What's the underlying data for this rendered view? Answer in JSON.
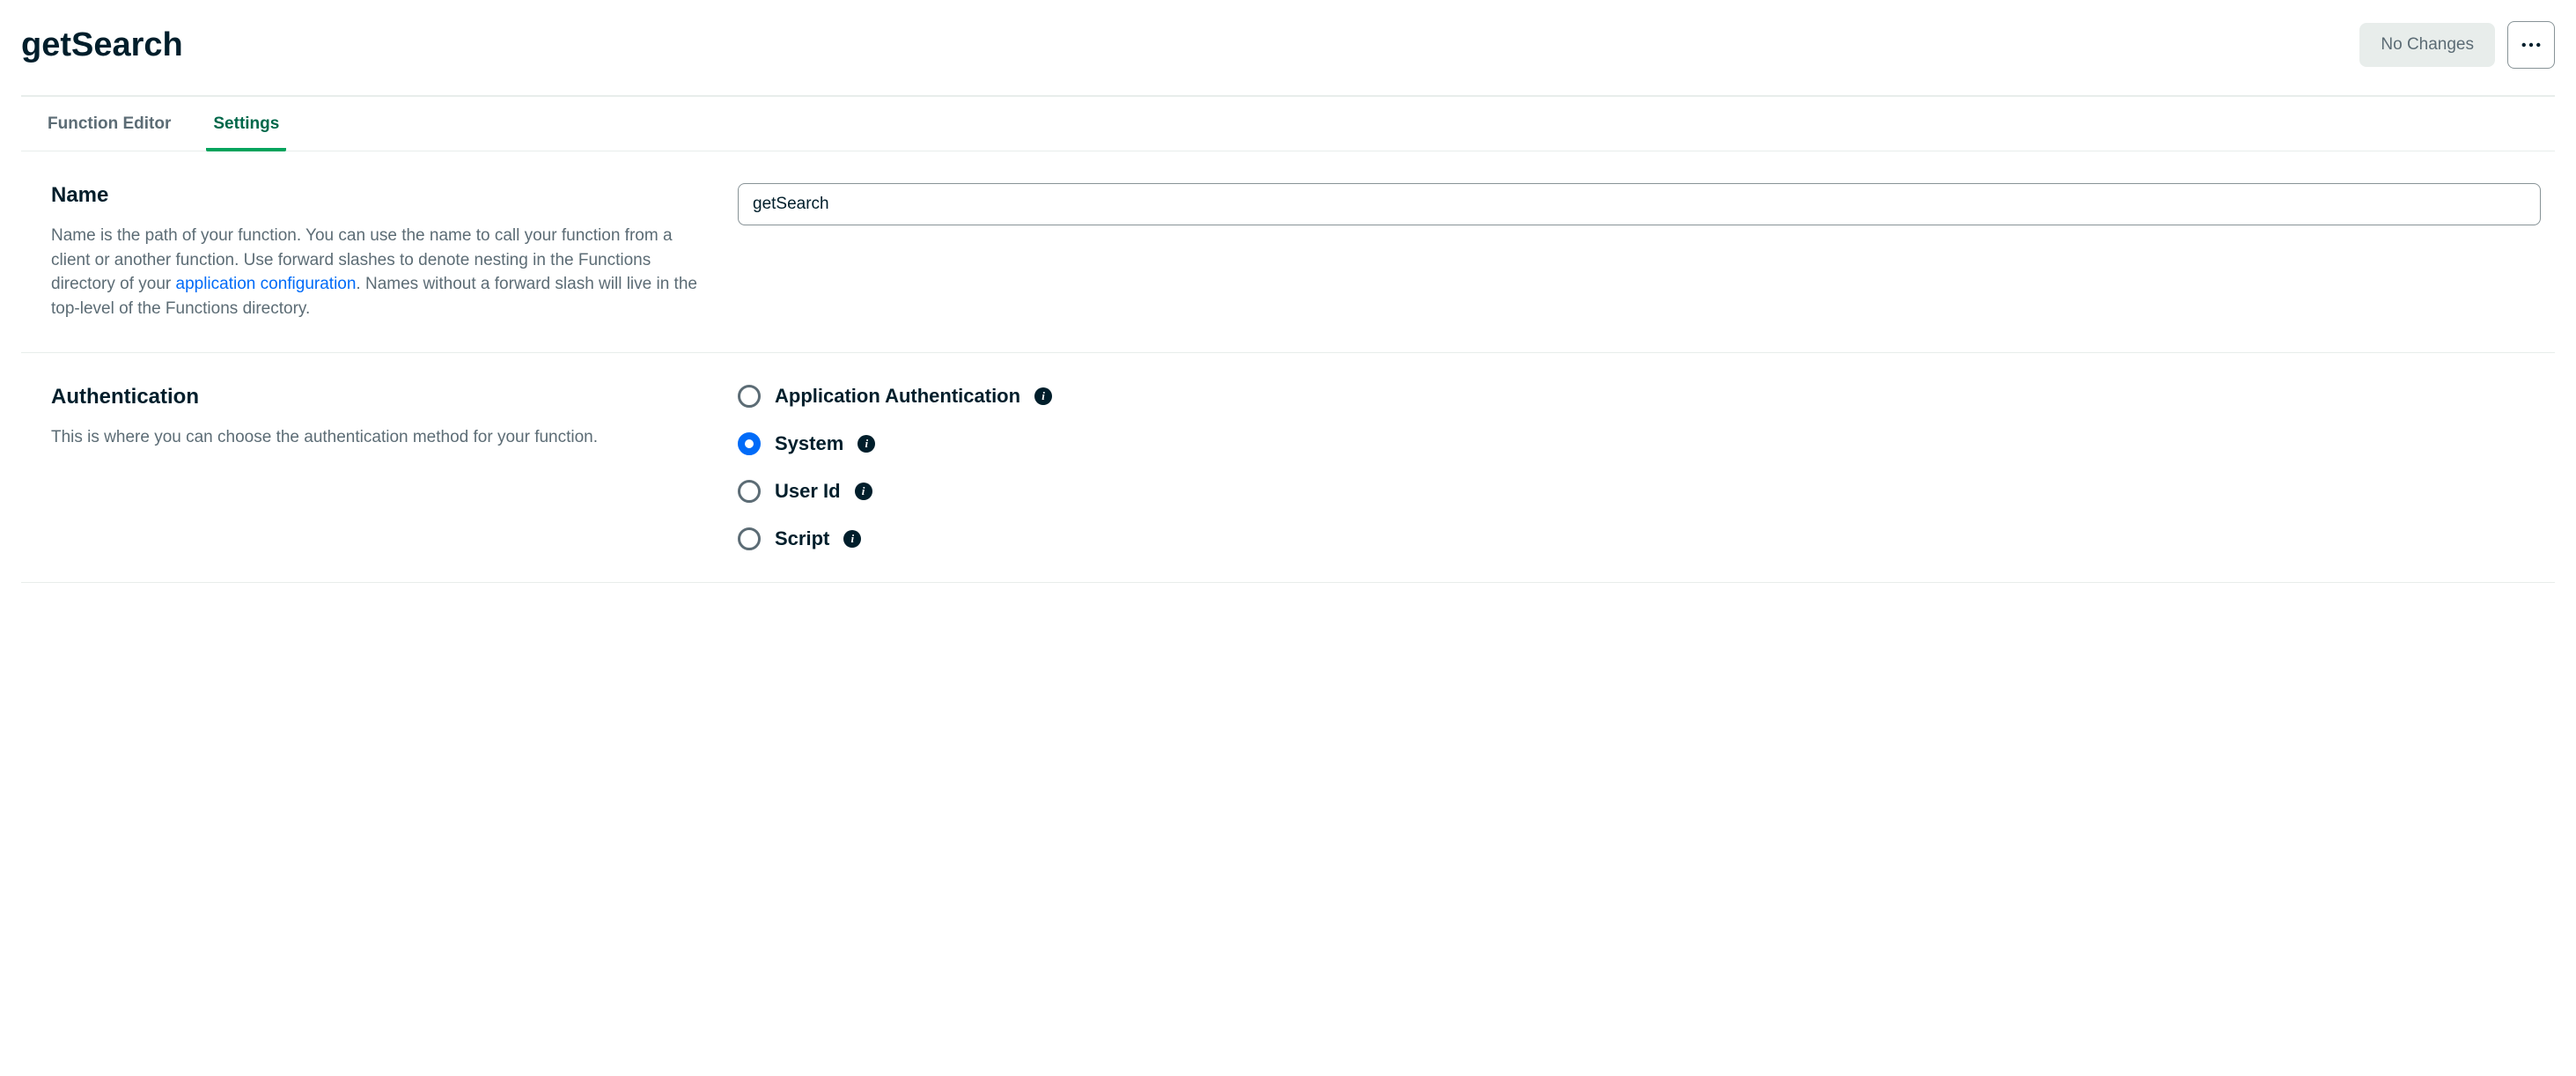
{
  "header": {
    "title": "getSearch",
    "no_changes_label": "No Changes"
  },
  "tabs": {
    "editor": "Function Editor",
    "settings": "Settings",
    "active": "settings"
  },
  "name_section": {
    "heading": "Name",
    "desc_part1": "Name is the path of your function. You can use the name to call your function from a client or another function. Use forward slashes to denote nesting in the Functions directory of your ",
    "link_text": "application configuration",
    "desc_part2": ". Names without a forward slash will live in the top-level of the Functions directory.",
    "input_value": "getSearch"
  },
  "auth_section": {
    "heading": "Authentication",
    "desc": "This is where you can choose the authentication method for your function.",
    "options": [
      {
        "label": "Application Authentication",
        "selected": false
      },
      {
        "label": "System",
        "selected": true
      },
      {
        "label": "User Id",
        "selected": false
      },
      {
        "label": "Script",
        "selected": false
      }
    ]
  }
}
